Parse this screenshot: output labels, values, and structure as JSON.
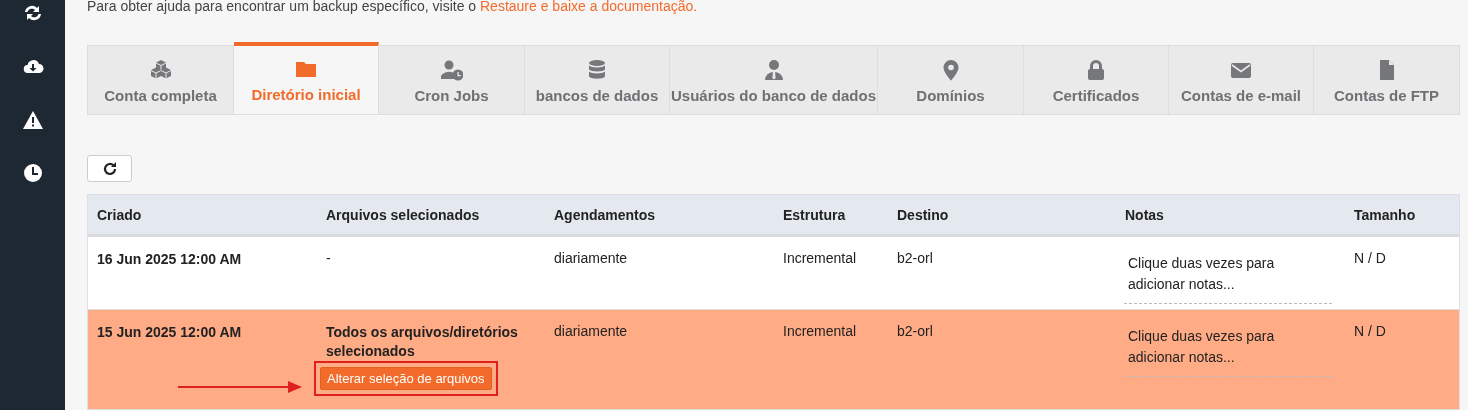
{
  "sidebar": {
    "items": [
      {
        "kind": "sync"
      },
      {
        "kind": "download"
      },
      {
        "kind": "warning"
      },
      {
        "kind": "clock"
      }
    ]
  },
  "help_text": {
    "text": "Para obter ajuda para encontrar um backup específico, visite o",
    "link": "Restaure e baixe a documentação."
  },
  "tabs": [
    {
      "label": "Conta completa",
      "kind": "cubes",
      "selected": false
    },
    {
      "label": "Diretório inicial",
      "kind": "folder",
      "selected": true
    },
    {
      "label": "Cron Jobs",
      "kind": "cron",
      "selected": false
    },
    {
      "label": "bancos de dados",
      "kind": "database",
      "selected": false
    },
    {
      "label": "Usuários do banco de dados",
      "kind": "user",
      "selected": false
    },
    {
      "label": "Domínios",
      "kind": "pin",
      "selected": false
    },
    {
      "label": "Certificados",
      "kind": "lock",
      "selected": false
    },
    {
      "label": "Contas de e-mail",
      "kind": "envelope",
      "selected": false
    },
    {
      "label": "Contas de FTP",
      "kind": "file",
      "selected": false
    }
  ],
  "table": {
    "columns": [
      "Criado",
      "Arquivos selecionados",
      "Agendamentos",
      "Estrutura",
      "Destino",
      "Notas",
      "Tamanho"
    ],
    "rows": [
      {
        "selected": false,
        "created": "16 Jun 2025 12:00 AM",
        "files": "-",
        "schedule": "diariamente",
        "structure": "Incremental",
        "destination": "b2-orl",
        "notes": "Clique duas vezes para adicionar notas...",
        "size": "N / D"
      },
      {
        "selected": true,
        "created": "15 Jun 2025 12:00 AM",
        "files": "Todos os arquivos/diretórios selecionados",
        "files_bold": true,
        "action": {
          "label": "Alterar seleção de arquivos",
          "highlighted": true
        },
        "schedule": "diariamente",
        "structure": "Incremental",
        "destination": "b2-orl",
        "notes": "Clique duas vezes para adicionar notas...",
        "size": "N / D"
      }
    ]
  }
}
